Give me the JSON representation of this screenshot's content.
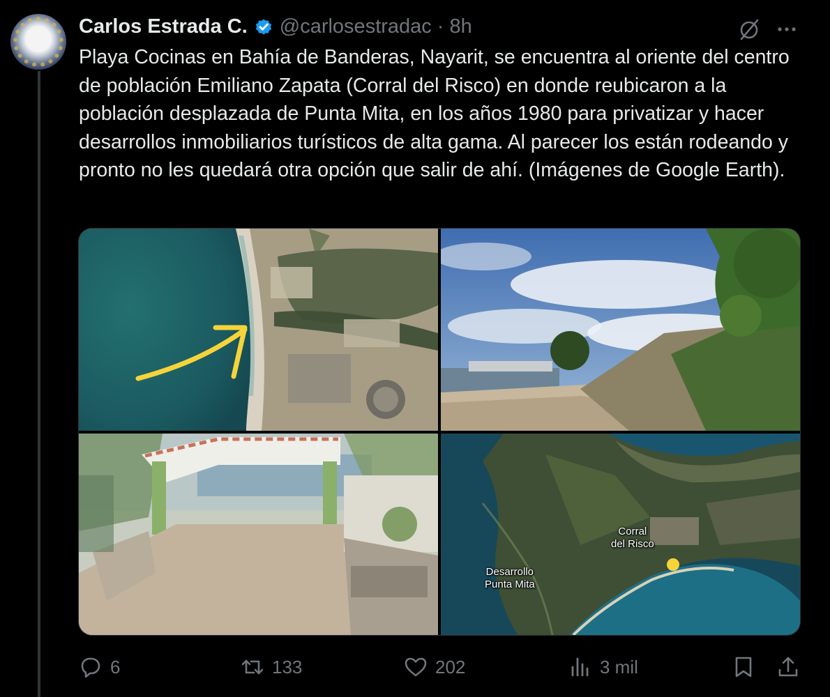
{
  "tweet": {
    "author_name": "Carlos Estrada C.",
    "handle": "@carlosestradac",
    "separator": "·",
    "time": "8h",
    "text": "Playa Cocinas en Bahía de Banderas, Nayarit, se encuentra al oriente del centro de población Emiliano Zapata (Corral del Risco) en donde reubicaron a la población desplazada de Punta Mita, en los años 1980 para privatizar y hacer desarrollos inmobiliarios turísticos de alta gama. Al parecer los están rodeando y pronto no les quedará otra opción que salir de ahí. (Imágenes de Google Earth)."
  },
  "icons": {
    "verified": "verified-badge-icon",
    "grok": "grok-icon",
    "more": "more-icon",
    "reply": "reply-icon",
    "repost": "repost-icon",
    "like": "like-icon",
    "views": "views-icon",
    "bookmark": "bookmark-icon",
    "share": "share-icon"
  },
  "media": {
    "map_labels": {
      "corral": "Corral\ndel Risco",
      "desarrollo": "Desarrollo\nPunta Mita"
    }
  },
  "actions": {
    "replies": "6",
    "reposts": "133",
    "likes": "202",
    "views": "3 mil"
  },
  "colors": {
    "background": "#000000",
    "text": "#e7e9ea",
    "secondary": "#71767b",
    "verified": "#1d9bf0",
    "arrow": "#f5d43a"
  }
}
